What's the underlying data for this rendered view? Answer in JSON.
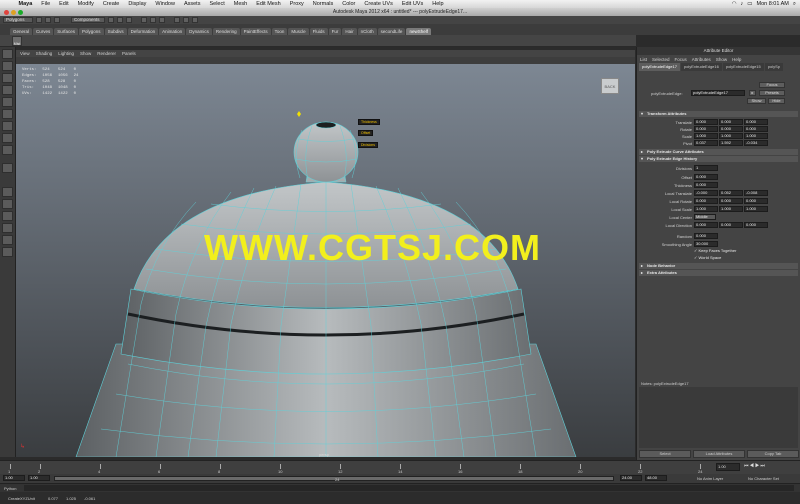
{
  "mac_menu": {
    "app": "Maya",
    "items": [
      "File",
      "Edit",
      "Modify",
      "Create",
      "Display",
      "Window",
      "Assets",
      "Select",
      "Mesh",
      "Edit Mesh",
      "Proxy",
      "Normals",
      "Color",
      "Create UVs",
      "Edit UVs",
      "Help"
    ],
    "clock": "Mon 8:01 AM"
  },
  "window_title": "Autodesk Maya 2012 x64 : untitled* --- polyExtrudeEdge17...",
  "status_line": {
    "mode": "Polygons",
    "field": "Components"
  },
  "shelf": {
    "tabs": [
      "General",
      "Curves",
      "Surfaces",
      "Polygons",
      "Subdivs",
      "Deformation",
      "Animation",
      "Dynamics",
      "Rendering",
      "PaintEffects",
      "Toon",
      "Muscle",
      "Fluids",
      "Fur",
      "Hair",
      "nCloth",
      "secondLife",
      "newShelf"
    ],
    "active_tab": "newShelf",
    "mist_label": "Mist"
  },
  "viewport": {
    "menu": [
      "View",
      "Shading",
      "Lighting",
      "Show",
      "Renderer",
      "Panels"
    ],
    "hud": [
      {
        "label": "Verts:",
        "a": "524",
        "b": "524",
        "c": "0"
      },
      {
        "label": "Edges:",
        "a": "1056",
        "b": "1056",
        "c": "24"
      },
      {
        "label": "Faces:",
        "a": "528",
        "b": "528",
        "c": "0"
      },
      {
        "label": "Tris:",
        "a": "1048",
        "b": "1048",
        "c": "0"
      },
      {
        "label": "UVs:",
        "a": "1422",
        "b": "1422",
        "c": "0"
      }
    ],
    "manip_tags": [
      "Thickness",
      "Offset",
      "Divisions"
    ],
    "camera": "persp",
    "view_cube": "BACK"
  },
  "watermark": "WWW.CGTSJ.COM",
  "attribute_editor": {
    "title": "Attribute Editor",
    "menu": [
      "List",
      "Selected",
      "Focus",
      "Attributes",
      "Show",
      "Help"
    ],
    "tabs": [
      "polyExtrudeEdge17",
      "polyExtrudeEdge16",
      "polyExtrudeEdge15",
      "polySp"
    ],
    "node_label": "polyExtrudeEdge:",
    "node_value": "polyExtrudeEdge17",
    "buttons": {
      "focus": "Focus",
      "presets": "Presets",
      "show": "Show",
      "hide": "Hide"
    },
    "sections": {
      "transform": "Transform Attributes",
      "curve": "Poly Extrude Curve Attributes",
      "history": "Poly Extrude Edge History",
      "node_behavior": "Node Behavior",
      "extra": "Extra Attributes"
    },
    "transform_rows": [
      {
        "label": "Translate",
        "v": [
          "0.000",
          "0.000",
          "0.000"
        ]
      },
      {
        "label": "Rotate",
        "v": [
          "0.000",
          "0.000",
          "0.000"
        ]
      },
      {
        "label": "Scale",
        "v": [
          "1.000",
          "1.000",
          "1.000"
        ]
      },
      {
        "label": "Pivot",
        "v": [
          "0.037",
          "1.592",
          "-0.034"
        ]
      }
    ],
    "history_single": [
      {
        "label": "Divisions",
        "v": "1"
      },
      {
        "label": "Offset",
        "v": "0.000"
      },
      {
        "label": "Thickness",
        "v": "0.000"
      }
    ],
    "history_triple": [
      {
        "label": "Local Translate",
        "v": [
          "-0.000",
          "0.052",
          "-0.008"
        ]
      },
      {
        "label": "Local Rotate",
        "v": [
          "0.000",
          "0.000",
          "0.000"
        ]
      },
      {
        "label": "Local Scale",
        "v": [
          "1.000",
          "1.000",
          "1.000"
        ]
      }
    ],
    "local_center_label": "Local Center",
    "local_center_value": "Middle",
    "local_direction_label": "Local Direction",
    "local_direction_v": [
      "0.000",
      "0.000",
      "0.000"
    ],
    "random_label": "Random",
    "random_value": "0.000",
    "smoothing_label": "Smoothing Angle",
    "smoothing_value": "30.000",
    "keep_faces": "Keep Faces Together",
    "world_space": "World Space",
    "notes_label": "Notes: polyExtrudeEdge17",
    "bottom_buttons": [
      "Select",
      "Load Attributes",
      "Copy Tab"
    ]
  },
  "time_slider": {
    "ticks": [
      "1",
      "2",
      "4",
      "6",
      "8",
      "10",
      "12",
      "14",
      "16",
      "18",
      "20",
      "22",
      "24"
    ],
    "current": "1.00"
  },
  "range_slider": {
    "start": "1.00",
    "inner_start": "1.00",
    "inner_end": "24",
    "end_a": "24.00",
    "end_b": "48.00",
    "anim_layer": "No Anim Layer",
    "char_set": "No Character Set"
  },
  "command_line": {
    "lang": "Python"
  },
  "help_line": {
    "text": "CreateXYZUnit",
    "values": [
      "0.077",
      "1.025",
      "-0.061"
    ]
  }
}
